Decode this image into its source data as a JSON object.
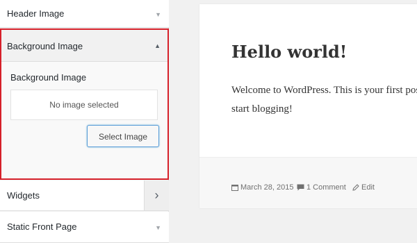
{
  "customizer": {
    "sections": {
      "header_image": {
        "title": "Header Image"
      },
      "background_image": {
        "title": "Background Image",
        "control_label": "Background Image",
        "placeholder": "No image selected",
        "button_label": "Select Image"
      },
      "widgets": {
        "title": "Widgets"
      },
      "static_front_page": {
        "title": "Static Front Page"
      }
    }
  },
  "preview": {
    "post": {
      "title": "Hello world!",
      "body_line1": "Welcome to WordPress. This is your first post.",
      "body_line2": "start blogging!",
      "date": "March 28, 2015",
      "comments": "1 Comment",
      "edit": "Edit"
    }
  },
  "icons": {
    "expand": "chevron-down-icon",
    "collapse": "chevron-up-icon",
    "navigate": "chevron-right-icon",
    "date": "calendar-icon",
    "comments": "comment-icon",
    "edit": "pencil-icon"
  },
  "colors": {
    "highlight_border": "#d6202a",
    "button_focus": "#5b9dd9"
  }
}
